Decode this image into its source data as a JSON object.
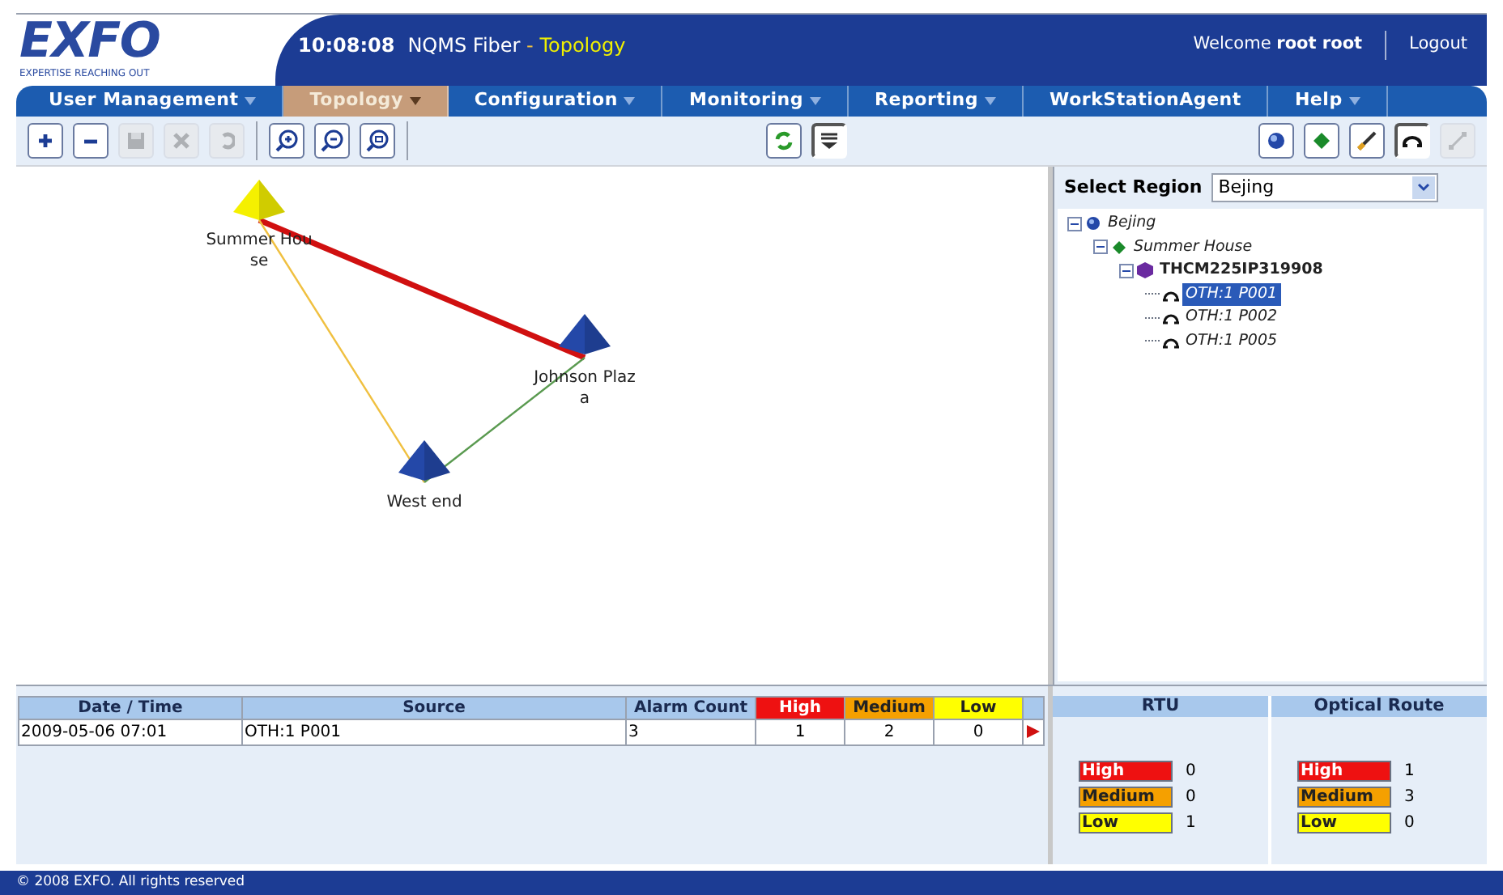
{
  "header": {
    "logo": "EXFO",
    "tagline": "EXPERTISE REACHING OUT",
    "time": "10:08:08",
    "app": "NQMS Fiber",
    "separator": "-",
    "page": "Topology",
    "welcome": "Welcome",
    "user": "root root",
    "logout": "Logout"
  },
  "menu": [
    {
      "label": "User Management",
      "selected": false,
      "has_menu": true
    },
    {
      "label": "Topology",
      "selected": true,
      "has_menu": true
    },
    {
      "label": "Configuration",
      "selected": false,
      "has_menu": true
    },
    {
      "label": "Monitoring",
      "selected": false,
      "has_menu": true
    },
    {
      "label": "Reporting",
      "selected": false,
      "has_menu": true
    },
    {
      "label": "WorkStationAgent",
      "selected": false,
      "has_menu": false
    },
    {
      "label": "Help",
      "selected": false,
      "has_menu": true
    }
  ],
  "toolbar_left": [
    {
      "kind": "add",
      "disabled": false
    },
    {
      "kind": "remove",
      "disabled": false
    },
    {
      "kind": "save",
      "disabled": true
    },
    {
      "kind": "delete",
      "disabled": true
    },
    {
      "kind": "undo",
      "disabled": true
    },
    {
      "kind": "zoomin",
      "disabled": false
    },
    {
      "kind": "zoomout",
      "disabled": false
    },
    {
      "kind": "zoomfit",
      "disabled": false
    }
  ],
  "toolbar_middle": [
    {
      "kind": "refresh",
      "selected": false
    },
    {
      "kind": "list",
      "selected": true
    }
  ],
  "toolbar_right": [
    {
      "kind": "globe",
      "selected": false,
      "disabled": false
    },
    {
      "kind": "diamond",
      "selected": false,
      "disabled": false
    },
    {
      "kind": "cable",
      "selected": false,
      "disabled": false
    },
    {
      "kind": "loop",
      "selected": true,
      "disabled": false
    },
    {
      "kind": "link",
      "selected": false,
      "disabled": true
    }
  ],
  "topology": {
    "nodes": [
      {
        "label": "Summer House",
        "color": "#f5f000"
      },
      {
        "label": "Johnson Plaza",
        "color": "#2448a8"
      },
      {
        "label": "West end",
        "color": "#2448a8"
      }
    ],
    "links": [
      {
        "color": "#d01010"
      },
      {
        "color": "#f0c040"
      },
      {
        "color": "#5a9a50"
      }
    ]
  },
  "region": {
    "label": "Select Region",
    "value": "Bejing"
  },
  "tree": [
    {
      "kind": "region",
      "label": "Bejing",
      "expanded": true,
      "selected": false,
      "children": [
        {
          "kind": "site",
          "label": "Summer House",
          "expanded": true,
          "selected": false,
          "children": [
            {
              "kind": "rtu",
              "label": "THCM225IP319908",
              "expanded": true,
              "selected": false,
              "children": [
                {
                  "kind": "port",
                  "label": "OTH:1 P001",
                  "selected": true
                },
                {
                  "kind": "port",
                  "label": "OTH:1 P002",
                  "selected": false
                },
                {
                  "kind": "port",
                  "label": "OTH:1 P005",
                  "selected": false
                }
              ]
            }
          ]
        }
      ]
    }
  ],
  "alarms": {
    "columns": [
      {
        "label": "Date / Time"
      },
      {
        "label": "Source"
      },
      {
        "label": "Alarm Count"
      },
      {
        "label": "High",
        "color": "#ee1111"
      },
      {
        "label": "Medium",
        "color": "#f5a000"
      },
      {
        "label": "Low",
        "color": "#ffff00"
      }
    ],
    "rows": [
      {
        "cells": [
          "2009-05-06 07:01",
          "OTH:1 P001",
          "3",
          "1",
          "2",
          "0"
        ]
      }
    ]
  },
  "summaries": [
    {
      "title": "RTU",
      "levels": [
        {
          "label": "High",
          "count": "0",
          "color": "#ee1111"
        },
        {
          "label": "Medium",
          "count": "0",
          "color": "#f5a000"
        },
        {
          "label": "Low",
          "count": "1",
          "color": "#ffff00"
        }
      ]
    },
    {
      "title": "Optical Route",
      "levels": [
        {
          "label": "High",
          "count": "1",
          "color": "#ee1111"
        },
        {
          "label": "Medium",
          "count": "3",
          "color": "#f5a000"
        },
        {
          "label": "Low",
          "count": "0",
          "color": "#ffff00"
        }
      ]
    }
  ],
  "footer": "© 2008 EXFO. All rights reserved"
}
